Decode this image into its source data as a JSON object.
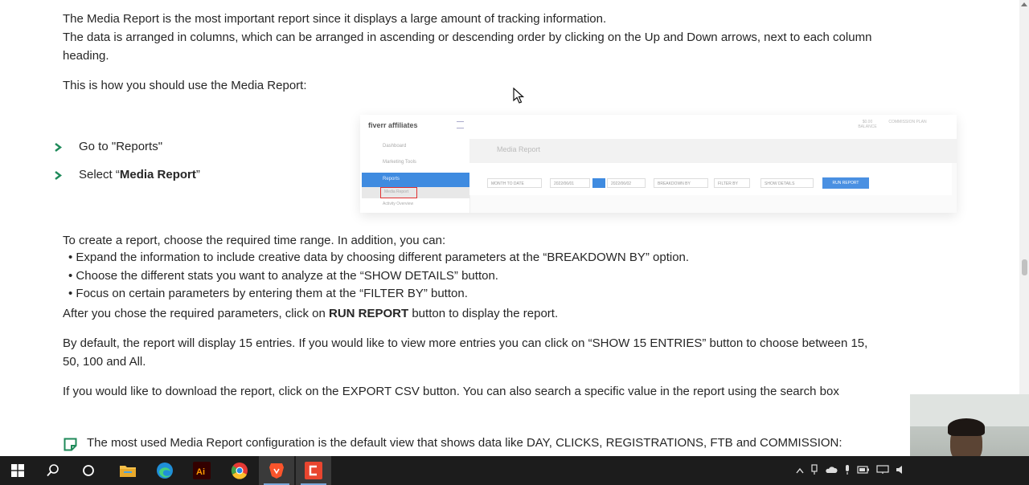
{
  "document": {
    "para1_line1": "The Media Report is the most important report since it displays a large amount of tracking information.",
    "para1_line2": "The data is arranged in columns, which can be arranged in ascending or descending order by clicking on the Up and Down arrows, next to each column",
    "para1_line3": "heading.",
    "how_to_use": "This is how you should use the Media Report:",
    "steps": [
      {
        "prefix": "Go to \"",
        "bold": "Reports",
        "suffix": "\""
      },
      {
        "prefix": "Select “",
        "bold": "Media Report",
        "suffix": "”"
      }
    ],
    "create_intro": "To create a report, choose the required time range. In addition, you can:",
    "bullets": [
      "Expand the information to include creative data by choosing different parameters at the “BREAKDOWN BY” option.",
      "Choose the different stats you want to analyze at the “SHOW DETAILS” button.",
      "Focus on certain parameters by entering them at the “FILTER BY” button."
    ],
    "after_prefix": "After you chose the required parameters, click on ",
    "after_bold": "RUN REPORT",
    "after_suffix": " button to display the report.",
    "default_line1": "By default, the report will display 15 entries. If you would like to view more entries you can click on “SHOW 15 ENTRIES” button to choose between 15,",
    "default_line2": "50, 100 and All.",
    "download_line": "If you would like to download the report, click on the EXPORT CSV button. You can also search a specific value in the report using the search box",
    "note_line": "The most used Media Report configuration is the default view that shows data like DAY, CLICKS, REGISTRATIONS, FTB and COMMISSION:"
  },
  "screenshot": {
    "logo": "fiverr affiliates",
    "sidebar_items": [
      "Dashboard",
      "Marketing Tools",
      "Reports"
    ],
    "sub_items": [
      "Media Report",
      "Activity Overview"
    ],
    "page_title": "Media Report",
    "filters": [
      "MONTH TO DATE",
      "2022/06/01",
      "2022/06/02",
      "BREAKDOWN BY",
      "FILTER BY",
      "SHOW DETAILS"
    ],
    "run_button": "RUN REPORT",
    "top_right": [
      "$0.00 BALANCE",
      "COMMISSION PLAN"
    ]
  },
  "taskbar": {
    "apps": [
      "windows-start",
      "search",
      "task-view",
      "file-explorer",
      "edge",
      "illustrator",
      "chrome",
      "brave",
      "app-red"
    ],
    "active_app": "app-red"
  },
  "colors": {
    "text": "#262626",
    "chevron": "#1f8a5a",
    "taskbar": "#1c1c1c",
    "screenshot_accent": "#3f8be0"
  }
}
